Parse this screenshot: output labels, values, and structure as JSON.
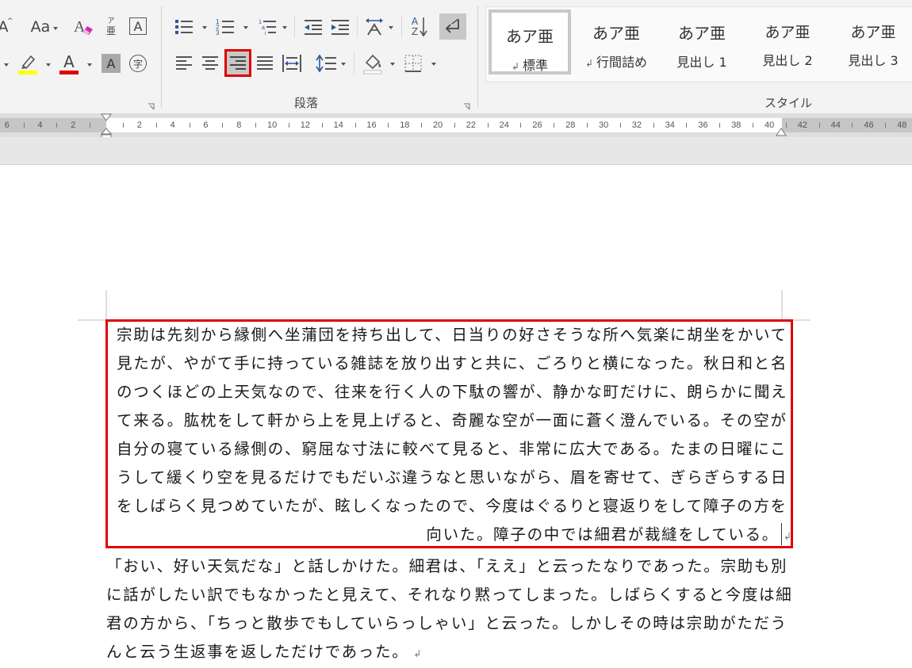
{
  "ribbon": {
    "font_group": {
      "font_size_partial": "A",
      "change_case": "Aa",
      "furigana_top": "ア",
      "furigana_bottom": "亜",
      "char_border": "A",
      "font_color_letter": "A",
      "char_shading": "A",
      "enclose_char": "字",
      "highlight_color": "#ffff00",
      "font_color": "#e00000"
    },
    "paragraph_group": {
      "label": "段落",
      "sort_label_top": "A",
      "sort_label_bottom": "Z",
      "selected_button": "align-right-button"
    },
    "styles_group": {
      "label": "スタイル",
      "items": [
        {
          "sample": "あア亜",
          "name": "標準",
          "selected": true,
          "mark": "↲"
        },
        {
          "sample": "あア亜",
          "name": "行間詰め",
          "selected": false,
          "mark": "↲"
        },
        {
          "sample": "あア亜",
          "name": "見出し 1",
          "selected": false,
          "mark": ""
        },
        {
          "sample": "あア亜",
          "name": "見出し 2",
          "selected": false,
          "mark": ""
        },
        {
          "sample": "あア亜",
          "name": "見出し 3",
          "selected": false,
          "mark": ""
        }
      ]
    }
  },
  "ruler": {
    "left_numbers": [
      "6",
      "4",
      "2"
    ],
    "right_numbers": [
      "2",
      "4",
      "6",
      "8",
      "10",
      "12",
      "14",
      "16",
      "18",
      "20",
      "22",
      "24",
      "26",
      "28",
      "30",
      "32",
      "34",
      "36",
      "38",
      "40",
      "42",
      "44",
      "46",
      "48"
    ]
  },
  "document": {
    "paragraph1": {
      "lines": [
        "宗助は先刻から縁側へ坐蒲団を持ち出して、日当りの好さそうな所へ気楽に胡坐をかいて",
        "見たが、やがて手に持っている雑誌を放り出すと共に、ごろりと横になった。秋日和と名",
        "のつくほどの上天気なので、往来を行く人の下駄の響が、静かな町だけに、朗らかに聞え",
        "て来る。肱枕をして軒から上を見上げると、奇麗な空が一面に蒼く澄んでいる。その空が",
        "自分の寝ている縁側の、窮屈な寸法に較べて見ると、非常に広大である。たまの日曜にこ",
        "うして緩くり空を見るだけでもだいぶ違うなと思いながら、眉を寄せて、ぎらぎらする日",
        "をしばらく見つめていたが、眩しくなったので、今度はぐるりと寝返りをして障子の方を",
        "向いた。障子の中では細君が裁縫をしている。"
      ],
      "alignment": "right",
      "selected": true
    },
    "paragraph2": {
      "lines": [
        "「おい、好い天気だな」と話しかけた。細君は、「ええ」と云ったなりであった。宗助も別",
        "に話がしたい訳でもなかったと見えて、それなり黙ってしまった。しばらくすると今度は細",
        "君の方から、「ちっと散歩でもしていらっしゃい」と云った。しかしその時は宗助がただう",
        "んと云う生返事を返しただけであった。"
      ]
    },
    "paragraph_mark": "↲"
  }
}
